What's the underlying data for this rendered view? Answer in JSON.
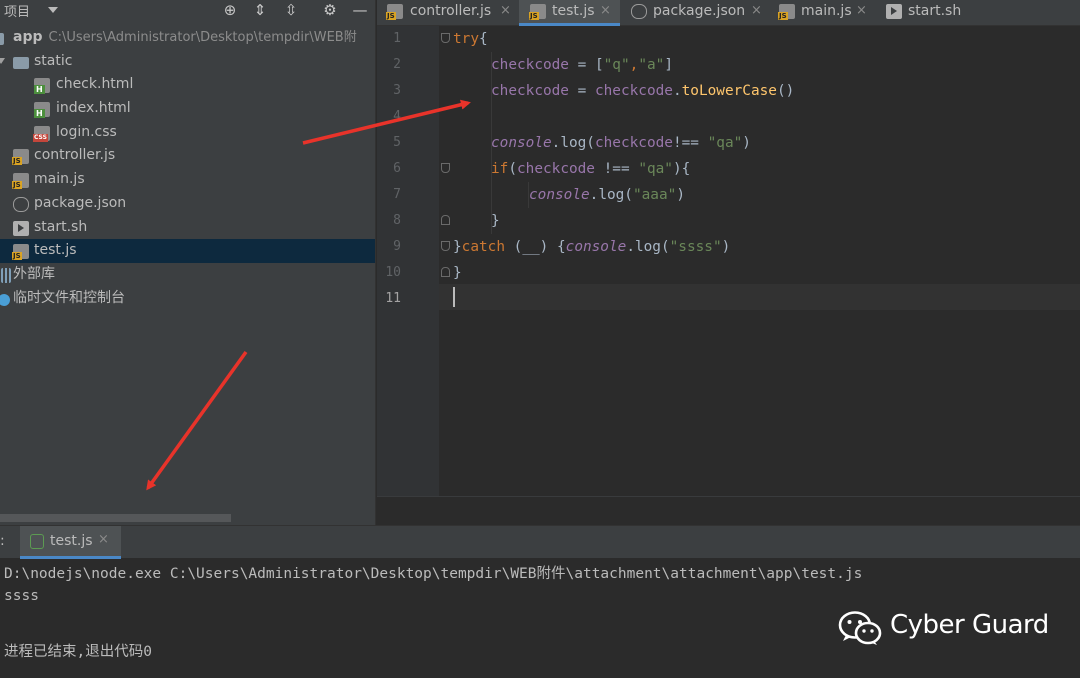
{
  "sidebar": {
    "title": "项目",
    "tree": [
      {
        "label": "app",
        "path": "C:\\Users\\Administrator\\Desktop\\tempdir\\WEB附"
      },
      {
        "label": "static"
      },
      {
        "label": "check.html"
      },
      {
        "label": "index.html"
      },
      {
        "label": "login.css"
      },
      {
        "label": "controller.js"
      },
      {
        "label": "main.js"
      },
      {
        "label": "package.json"
      },
      {
        "label": "start.sh"
      },
      {
        "label": "test.js"
      },
      {
        "label": "外部库"
      },
      {
        "label": "临时文件和控制台"
      }
    ]
  },
  "editor": {
    "tabs": [
      {
        "label": "controller.js",
        "icon": "js-file-icon"
      },
      {
        "label": "test.js",
        "icon": "js-file-icon",
        "active": true
      },
      {
        "label": "package.json",
        "icon": "json-file-icon"
      },
      {
        "label": "main.js",
        "icon": "js-file-icon"
      },
      {
        "label": "start.sh",
        "icon": "shell-file-icon"
      }
    ],
    "tab_close_glyph": "×",
    "line_numbers": [
      "1",
      "2",
      "3",
      "4",
      "5",
      "6",
      "7",
      "8",
      "9",
      "10",
      "11"
    ],
    "code": {
      "l1_try": "try",
      "l1_brace": "{",
      "l2_var": "checkcode",
      "l2_eq": " = [",
      "l2_s1": "\"q\"",
      "l2_comma": ",",
      "l2_s2": "\"a\"",
      "l2_close": "]",
      "l3_var": "checkcode",
      "l3_eq": " = ",
      "l3_var2": "checkcode",
      "l3_dot": ".",
      "l3_fn": "toLowerCase",
      "l3_paren": "()",
      "l5_console": "console",
      "l5_log": ".log(",
      "l5_var": "checkcode",
      "l5_op": "!== ",
      "l5_str": "\"qa\"",
      "l5_close": ")",
      "l6_if": "if",
      "l6_open": "(",
      "l6_var": "checkcode",
      "l6_op": " !== ",
      "l6_str": "\"qa\"",
      "l6_close": "){",
      "l7_console": "console",
      "l7_log": ".log(",
      "l7_str": "\"aaa\"",
      "l7_close": ")",
      "l8_brace": "}",
      "l9_brace": "}",
      "l9_catch": "catch",
      "l9_param": " (__) {",
      "l9_console": "console",
      "l9_log": ".log(",
      "l9_str": "\"ssss\"",
      "l9_close": ")",
      "l10_brace": "}"
    }
  },
  "run": {
    "tab_prefix": ":",
    "tab_label": "test.js",
    "tab_close": "×",
    "output": [
      "D:\\nodejs\\node.exe C:\\Users\\Administrator\\Desktop\\tempdir\\WEB附件\\attachment\\attachment\\app\\test.js",
      "ssss",
      "",
      "进程已结束,退出代码0"
    ]
  },
  "watermark": {
    "text": "Cyber Guard"
  },
  "colors": {
    "annotation_arrow": "#e8332a",
    "selection": "#0d293e",
    "tab_accent": "#4a88c7"
  }
}
